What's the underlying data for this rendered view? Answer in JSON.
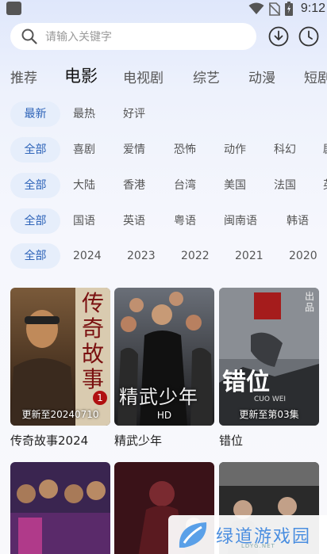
{
  "status": {
    "time": "9:12"
  },
  "search": {
    "placeholder": "请输入关键字"
  },
  "tabs": [
    "推荐",
    "电影",
    "电视剧",
    "综艺",
    "动漫",
    "短剧"
  ],
  "filters": {
    "sort": [
      "最新",
      "最热",
      "好评"
    ],
    "genre": [
      "全部",
      "喜剧",
      "爱情",
      "恐怖",
      "动作",
      "科幻",
      "剧"
    ],
    "region": [
      "全部",
      "大陆",
      "香港",
      "台湾",
      "美国",
      "法国",
      "英"
    ],
    "language": [
      "全部",
      "国语",
      "英语",
      "粤语",
      "闽南语",
      "韩语"
    ],
    "year": [
      "全部",
      "2024",
      "2023",
      "2022",
      "2021",
      "2020"
    ]
  },
  "movies": [
    {
      "title": "传奇故事2024",
      "badge": "更新至20240710",
      "poster_text": "传奇故事",
      "poster_num": "1"
    },
    {
      "title": "精武少年",
      "badge": "HD",
      "poster_text": "精武少年"
    },
    {
      "title": "错位",
      "badge": "更新至第03集",
      "poster_text": "错位",
      "poster_sub": "CUO WEI",
      "poster_side": "出品"
    }
  ],
  "watermark": {
    "text": "绿道游戏园",
    "sub": "LDYG.NET"
  },
  "colors": {
    "accent": "#2d63b8",
    "chip_bg": "#e6eefb",
    "watermark": "#4a8ee0"
  }
}
